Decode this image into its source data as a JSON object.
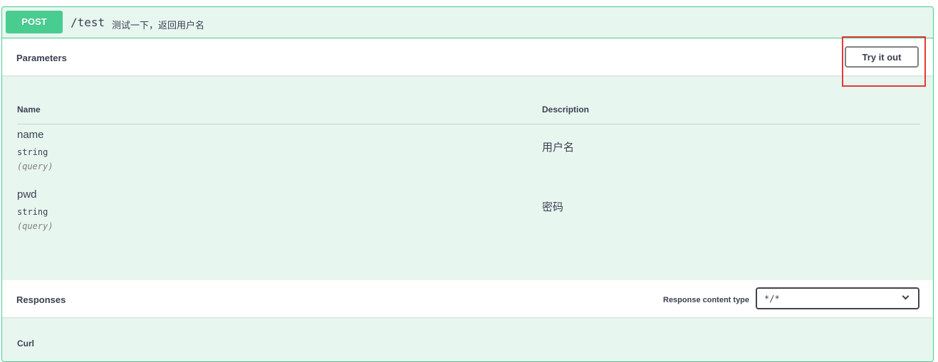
{
  "operation": {
    "method": "POST",
    "path": "/test",
    "summary": "测试一下，返回用户名"
  },
  "parameters_section": {
    "title": "Parameters",
    "try_it_out_label": "Try it out",
    "columns": {
      "name": "Name",
      "description": "Description"
    },
    "params": [
      {
        "name": "name",
        "type": "string",
        "in": "(query)",
        "description": "用户名"
      },
      {
        "name": "pwd",
        "type": "string",
        "in": "(query)",
        "description": "密码"
      }
    ]
  },
  "responses_section": {
    "title": "Responses",
    "content_type_label": "Response content type",
    "content_type_value": "*/*"
  },
  "curl_label": "Curl",
  "colors": {
    "post_accent": "#49cc90",
    "block_background": "#e8f6f0",
    "highlight": "#e53935"
  }
}
